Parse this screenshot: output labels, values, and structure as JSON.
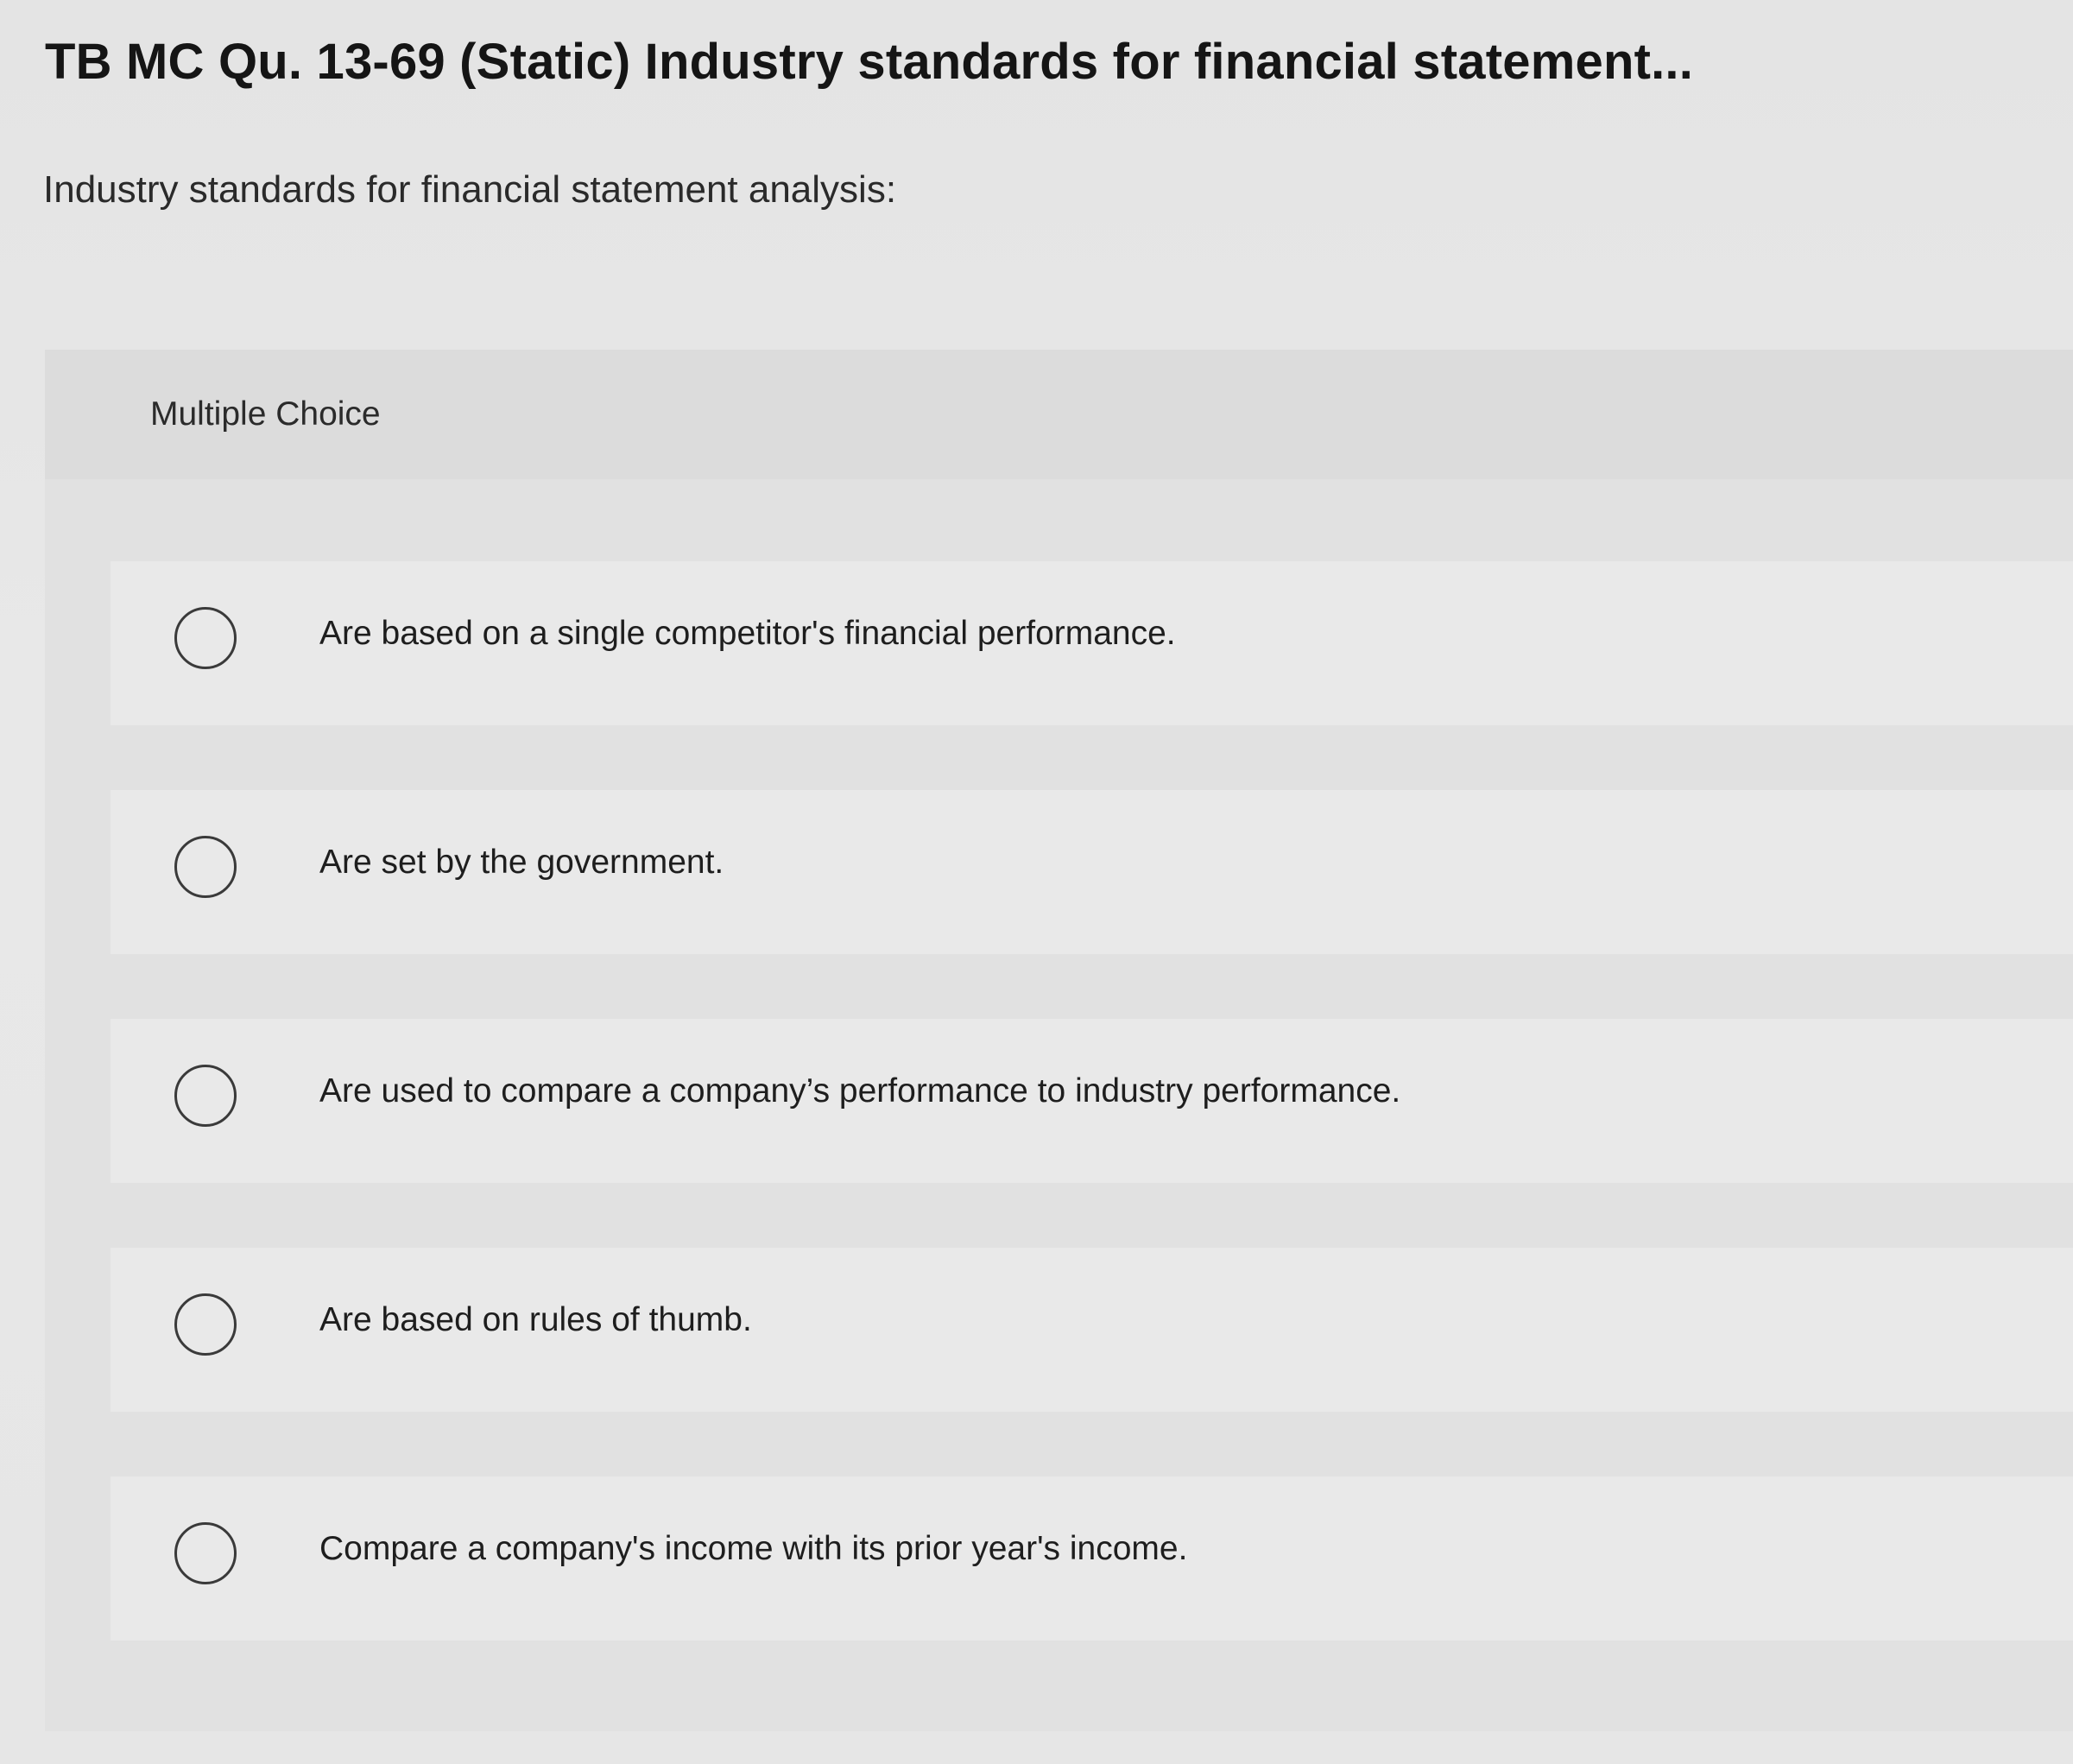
{
  "question": {
    "title": "TB MC Qu. 13-69 (Static) Industry standards for financial statement...",
    "prompt": "Industry standards for financial statement analysis:"
  },
  "multiple_choice": {
    "label": "Multiple Choice",
    "options": [
      {
        "text": "Are based on a single competitor's financial performance.",
        "selected": false
      },
      {
        "text": "Are set by the government.",
        "selected": false
      },
      {
        "text": "Are used to compare a company’s performance to industry performance.",
        "selected": false
      },
      {
        "text": "Are based on rules of thumb.",
        "selected": false
      },
      {
        "text": "Compare a company's income with its prior year's income.",
        "selected": false
      }
    ]
  }
}
